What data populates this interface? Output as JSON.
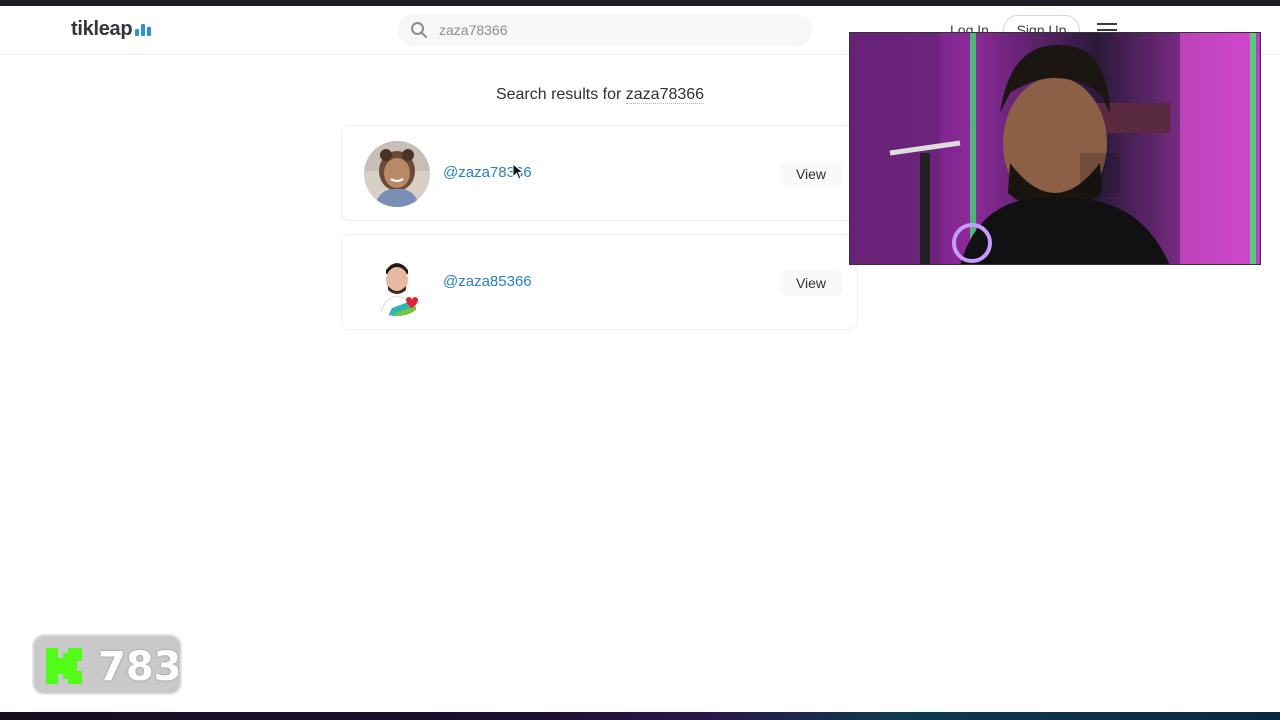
{
  "header": {
    "logo_text": "tikleap",
    "search_value": "zaza78366",
    "login_label": "Log In",
    "signup_label": "Sign Up"
  },
  "results": {
    "prefix": "Search results for ",
    "query": "zaza78366",
    "items": [
      {
        "username": "@zaza78366",
        "action": "View"
      },
      {
        "username": "@zaza85366",
        "action": "View"
      }
    ]
  },
  "overlay": {
    "kick_count": "783"
  },
  "colors": {
    "accent": "#2a7fc0",
    "logo_bars": "#2f8de4",
    "kick_green": "#53fc18"
  }
}
